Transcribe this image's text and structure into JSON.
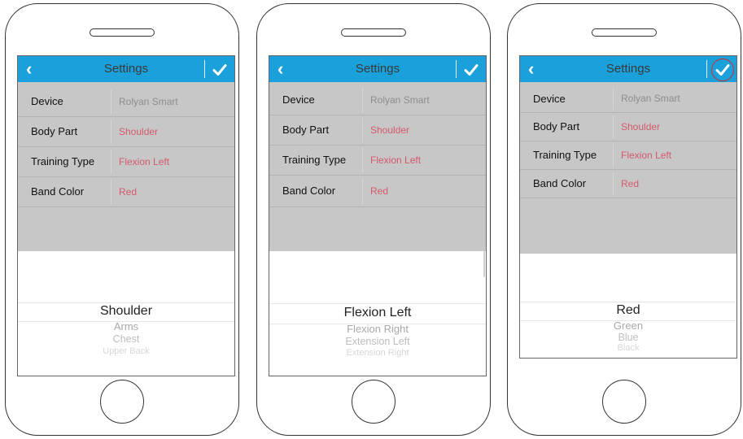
{
  "phones": [
    {
      "navbar": {
        "back_icon": "chevron-left-icon",
        "title": "Settings",
        "confirm_icon": "checkmark-icon",
        "confirm_highlighted": false
      },
      "settings": [
        {
          "label": "Device",
          "value": "Rolyan Smart"
        },
        {
          "label": "Body Part",
          "value": "Shoulder"
        },
        {
          "label": "Training Type",
          "value": "Flexion Left"
        },
        {
          "label": "Band Color",
          "value": "Red"
        }
      ],
      "picker": {
        "selected": "Shoulder",
        "options_below": [
          "Arms",
          "Chest",
          "Upper Back",
          ""
        ]
      }
    },
    {
      "navbar": {
        "back_icon": "chevron-left-icon",
        "title": "Settings",
        "confirm_icon": "checkmark-icon",
        "confirm_highlighted": false
      },
      "settings": [
        {
          "label": "Device",
          "value": "Rolyan Smart"
        },
        {
          "label": "Body Part",
          "value": "Shoulder"
        },
        {
          "label": "Training Type",
          "value": "Flexion Left"
        },
        {
          "label": "Band Color",
          "value": "Red"
        }
      ],
      "picker": {
        "selected": "Flexion Left",
        "options_below": [
          "Flexion Right",
          "Extension Left",
          "Extension Right",
          ""
        ]
      }
    },
    {
      "navbar": {
        "back_icon": "chevron-left-icon",
        "title": "Settings",
        "confirm_icon": "checkmark-icon",
        "confirm_highlighted": true
      },
      "settings": [
        {
          "label": "Device",
          "value": "Rolyan Smart"
        },
        {
          "label": "Body Part",
          "value": "Shoulder"
        },
        {
          "label": "Training Type",
          "value": "Flexion Left"
        },
        {
          "label": "Band Color",
          "value": "Red"
        }
      ],
      "picker": {
        "selected": "Red",
        "options_below": [
          "Green",
          "Blue",
          "Black"
        ]
      }
    }
  ],
  "colors": {
    "navbar": "#1aa0da",
    "device_value": "#8d8d8d",
    "selected_value": "#d4596c",
    "confirm_highlight": "#d42b2b"
  }
}
